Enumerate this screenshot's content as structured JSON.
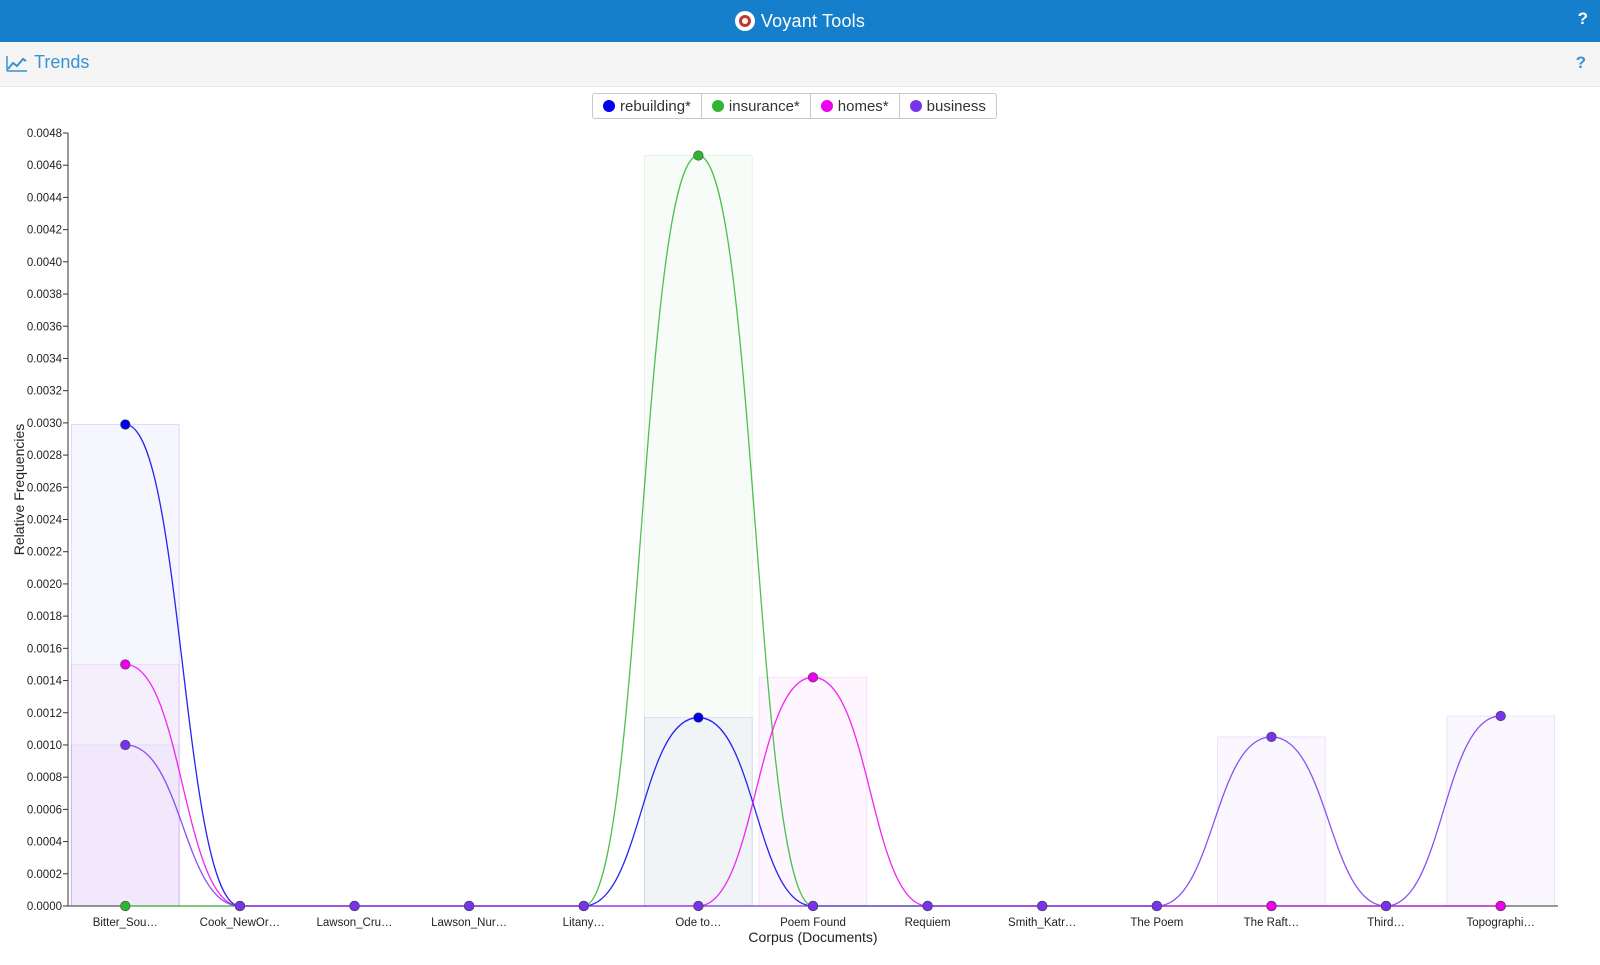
{
  "app": {
    "title": "Voyant Tools",
    "help": "?"
  },
  "panel": {
    "title": "Trends",
    "help": "?"
  },
  "chart_data": {
    "type": "line",
    "xlabel": "Corpus (Documents)",
    "ylabel": "Relative Frequencies",
    "ylim": [
      0,
      0.0048
    ],
    "yticks": [
      "0.0000",
      "0.0002",
      "0.0004",
      "0.0006",
      "0.0008",
      "0.0010",
      "0.0012",
      "0.0014",
      "0.0016",
      "0.0018",
      "0.0020",
      "0.0022",
      "0.0024",
      "0.0026",
      "0.0028",
      "0.0030",
      "0.0032",
      "0.0034",
      "0.0036",
      "0.0038",
      "0.0040",
      "0.0042",
      "0.0044",
      "0.0046",
      "0.0048"
    ],
    "categories": [
      "Bitter_Sou…",
      "Cook_NewOr…",
      "Lawson_Cru…",
      "Lawson_Nur…",
      "Litany…",
      "Ode to…",
      "Poem Found",
      "Requiem",
      "Smith_Katr…",
      "The Poem",
      "The Raft…",
      "Third…",
      "Topographi…"
    ],
    "series": [
      {
        "name": "rebuilding*",
        "color": "#0000ee",
        "values": [
          0.00299,
          0,
          0,
          0,
          0,
          0.00117,
          0,
          0,
          0,
          0,
          0,
          0,
          0
        ]
      },
      {
        "name": "insurance*",
        "color": "#2fb52f",
        "values": [
          0,
          0,
          0,
          0,
          0,
          0.00466,
          0,
          0,
          0,
          0,
          0,
          0,
          0
        ]
      },
      {
        "name": "homes*",
        "color": "#ee00ee",
        "values": [
          0.0015,
          0,
          0,
          0,
          0,
          0,
          0.00142,
          0,
          0,
          0,
          0,
          0,
          0
        ]
      },
      {
        "name": "business",
        "color": "#7733ee",
        "values": [
          0.001,
          0,
          0,
          0,
          0,
          0,
          0,
          0,
          0,
          0,
          0.00105,
          0,
          0.00118
        ]
      }
    ]
  }
}
